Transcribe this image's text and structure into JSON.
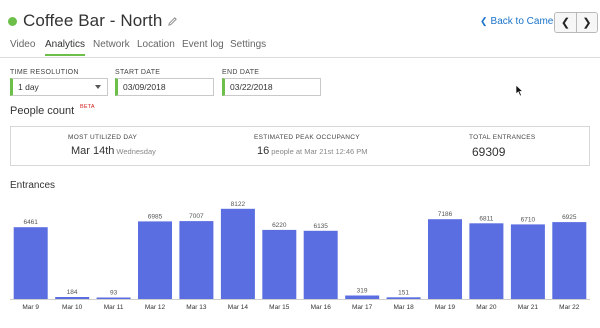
{
  "header": {
    "title": "Coffee Bar - North",
    "back_label": "Back to Cameras",
    "status_color": "#6cc04a",
    "prev_icon": "chevron-left-icon",
    "next_icon": "chevron-right-icon"
  },
  "tabs": [
    {
      "label": "Video",
      "active": false
    },
    {
      "label": "Analytics",
      "active": true
    },
    {
      "label": "Network",
      "active": false
    },
    {
      "label": "Location",
      "active": false
    },
    {
      "label": "Event log",
      "active": false
    },
    {
      "label": "Settings",
      "active": false
    }
  ],
  "filters": {
    "time_resolution": {
      "label": "TIME RESOLUTION",
      "value": "1 day"
    },
    "start_date": {
      "label": "START DATE",
      "value": "03/09/2018"
    },
    "end_date": {
      "label": "END DATE",
      "value": "03/22/2018"
    }
  },
  "people_count": {
    "title": "People count",
    "badge": "BETA",
    "most_utilized": {
      "label": "MOST UTILIZED DAY",
      "value": "Mar 14th",
      "sub": "Wednesday"
    },
    "peak": {
      "label": "ESTIMATED PEAK OCCUPANCY",
      "value": "16",
      "sub": "people at Mar 21st 12:46 PM"
    },
    "total": {
      "label": "TOTAL ENTRANCES",
      "value": "69309"
    }
  },
  "entrances": {
    "title": "Entrances"
  },
  "accent_color": "#6cc04a",
  "link_color": "#1a73c9",
  "chart_data": {
    "type": "bar",
    "categories": [
      "Mar 9",
      "Mar 10",
      "Mar 11",
      "Mar 12",
      "Mar 13",
      "Mar 14",
      "Mar 15",
      "Mar 16",
      "Mar 17",
      "Mar 18",
      "Mar 19",
      "Mar 20",
      "Mar 21",
      "Mar 22"
    ],
    "values": [
      6461,
      184,
      93,
      6985,
      7007,
      8122,
      6220,
      6135,
      319,
      151,
      7186,
      6811,
      6710,
      6925
    ],
    "data_labels": [
      "6461",
      "184",
      "93",
      "6985",
      "7007",
      "8122",
      "6220",
      "6135",
      "319",
      "151",
      "7186",
      "6811",
      "6710",
      "6925"
    ],
    "title": "",
    "xlabel": "",
    "ylabel": "",
    "ylim": [
      0,
      9000
    ],
    "bar_color": "#5b6ee1",
    "grid": false
  }
}
